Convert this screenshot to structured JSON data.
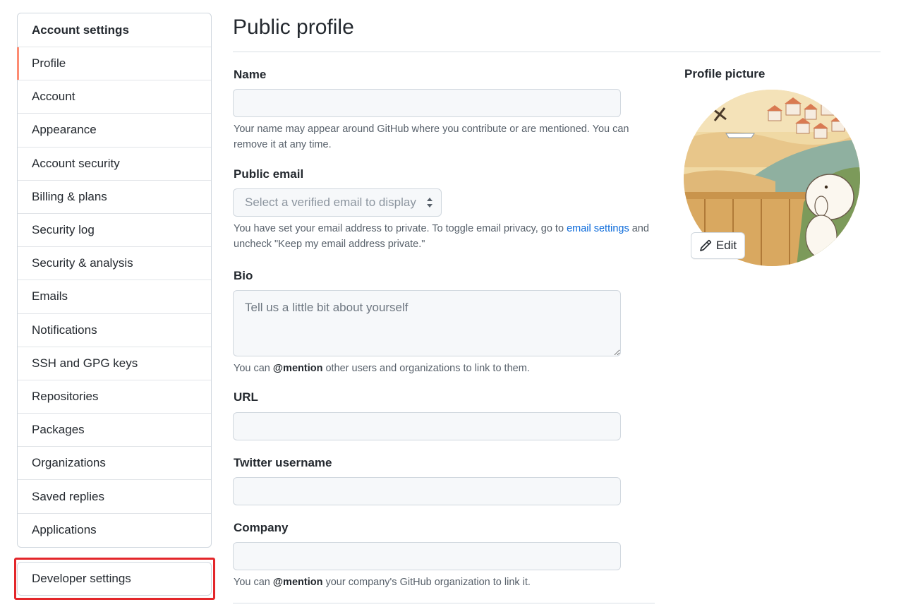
{
  "sidebar": {
    "header": "Account settings",
    "items": [
      {
        "label": "Profile"
      },
      {
        "label": "Account"
      },
      {
        "label": "Appearance"
      },
      {
        "label": "Account security"
      },
      {
        "label": "Billing & plans"
      },
      {
        "label": "Security log"
      },
      {
        "label": "Security & analysis"
      },
      {
        "label": "Emails"
      },
      {
        "label": "Notifications"
      },
      {
        "label": "SSH and GPG keys"
      },
      {
        "label": "Repositories"
      },
      {
        "label": "Packages"
      },
      {
        "label": "Organizations"
      },
      {
        "label": "Saved replies"
      },
      {
        "label": "Applications"
      }
    ],
    "selected": "Profile",
    "developer_settings": "Developer settings"
  },
  "main": {
    "title": "Public profile",
    "name": {
      "label": "Name",
      "value": "",
      "note": "Your name may appear around GitHub where you contribute or are mentioned. You can remove it at any time."
    },
    "public_email": {
      "label": "Public email",
      "selected": "Select a verified email to display",
      "note_before": "You have set your email address to private. To toggle email privacy, go to ",
      "note_link": "email settings",
      "note_after": " and uncheck \"Keep my email address private.\""
    },
    "bio": {
      "label": "Bio",
      "placeholder": "Tell us a little bit about yourself",
      "note_before": "You can ",
      "note_bold": "@mention",
      "note_after": " other users and organizations to link to them."
    },
    "url": {
      "label": "URL",
      "value": ""
    },
    "twitter": {
      "label": "Twitter username",
      "value": ""
    },
    "company": {
      "label": "Company",
      "value": "",
      "note_before": "You can ",
      "note_bold": "@mention",
      "note_after": " your company's GitHub organization to link it."
    }
  },
  "profile_picture": {
    "label": "Profile picture",
    "edit_label": "Edit"
  },
  "colors": {
    "selected_indicator": "#fd8c73",
    "highlight_box": "#e3262a",
    "link": "#0969da"
  },
  "icons": {
    "edit": "pencil-icon",
    "select": "select-arrows-icon"
  }
}
